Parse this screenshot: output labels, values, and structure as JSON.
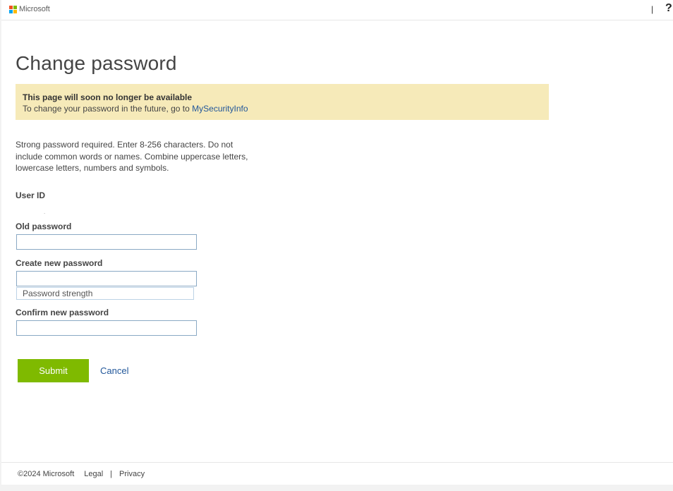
{
  "header": {
    "logo_text": "Microsoft",
    "logo_colors": [
      "#f25022",
      "#7fba00",
      "#00a4ef",
      "#ffb900"
    ],
    "separator": "|",
    "help_label": "?"
  },
  "main": {
    "title": "Change password",
    "banner": {
      "title": "This page will soon no longer be available",
      "body": "To change your password in the future, go to",
      "link_text": "MySecurityInfo"
    },
    "instructions": "Strong password required. Enter 8-256 characters. Do not include common words or names. Combine uppercase letters, lowercase letters, numbers and symbols.",
    "user_id": {
      "label": "User ID",
      "value": "."
    },
    "old_password": {
      "label": "Old password",
      "value": ""
    },
    "new_password": {
      "label": "Create new password",
      "value": "",
      "strength_text": "Password strength"
    },
    "confirm_password": {
      "label": "Confirm new password",
      "value": ""
    },
    "submit_label": "Submit",
    "cancel_label": "Cancel"
  },
  "footer": {
    "copyright": "©2024 Microsoft",
    "legal": "Legal",
    "separator": "|",
    "privacy": "Privacy"
  },
  "colors": {
    "accent": "#7fba00",
    "link": "#22579a",
    "banner_bg": "#f6eab9"
  }
}
